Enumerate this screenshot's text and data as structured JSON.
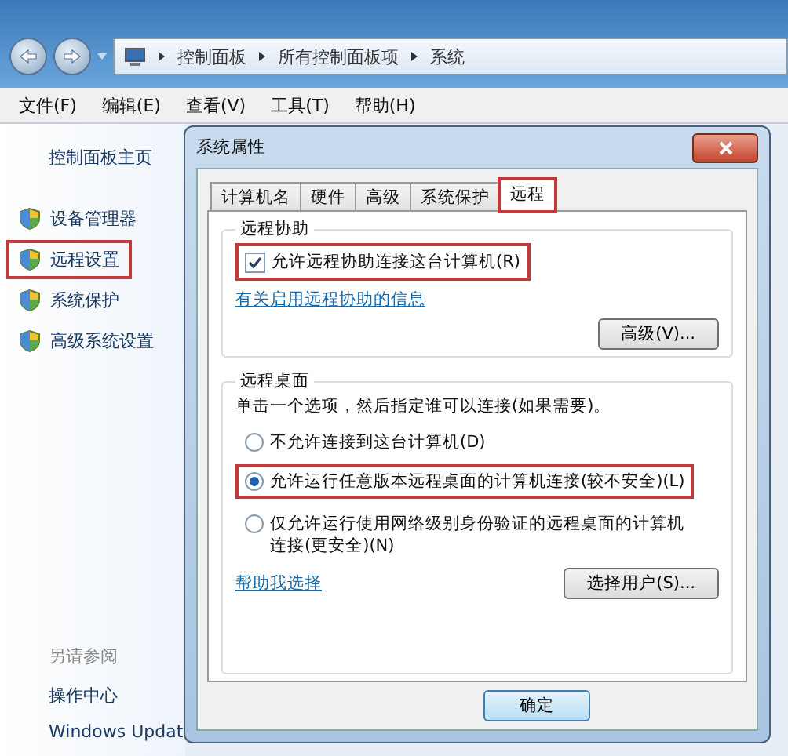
{
  "address_bar": {
    "path": [
      "控制面板",
      "所有控制面板项",
      "系统"
    ]
  },
  "menu_bar": [
    "文件(F)",
    "编辑(E)",
    "查看(V)",
    "工具(T)",
    "帮助(H)"
  ],
  "sidebar": {
    "home": "控制面板主页",
    "items": [
      {
        "label": "设备管理器",
        "highlighted": false
      },
      {
        "label": "远程设置",
        "highlighted": true
      },
      {
        "label": "系统保护",
        "highlighted": false
      },
      {
        "label": "高级系统设置",
        "highlighted": false
      }
    ],
    "see_also": {
      "heading": "另请参阅",
      "links": [
        "操作中心",
        "Windows Updat"
      ]
    }
  },
  "dialog": {
    "title": "系统属性",
    "tabs": [
      {
        "label": "计算机名",
        "selected": false,
        "highlighted": false
      },
      {
        "label": "硬件",
        "selected": false,
        "highlighted": false
      },
      {
        "label": "高级",
        "selected": false,
        "highlighted": false
      },
      {
        "label": "系统保护",
        "selected": false,
        "highlighted": false
      },
      {
        "label": "远程",
        "selected": true,
        "highlighted": true
      }
    ],
    "remote_assistance": {
      "heading": "远程协助",
      "checkbox": {
        "label": "允许远程协助连接这台计算机(R)",
        "checked": true,
        "highlighted": true
      },
      "link": "有关启用远程协助的信息",
      "button": "高级(V)..."
    },
    "remote_desktop": {
      "heading": "远程桌面",
      "description": "单击一个选项，然后指定谁可以连接(如果需要)。",
      "options": [
        {
          "label": "不允许连接到这台计算机(D)",
          "selected": false,
          "highlighted": false
        },
        {
          "label": "允许运行任意版本远程桌面的计算机连接(较不安全)(L)",
          "selected": true,
          "highlighted": true
        },
        {
          "label": "仅允许运行使用网络级别身份验证的远程桌面的计算机连接(更安全)(N)",
          "selected": false,
          "highlighted": false
        }
      ],
      "link": "帮助我选择",
      "button": "选择用户(S)..."
    },
    "buttons": [
      "确定"
    ]
  }
}
